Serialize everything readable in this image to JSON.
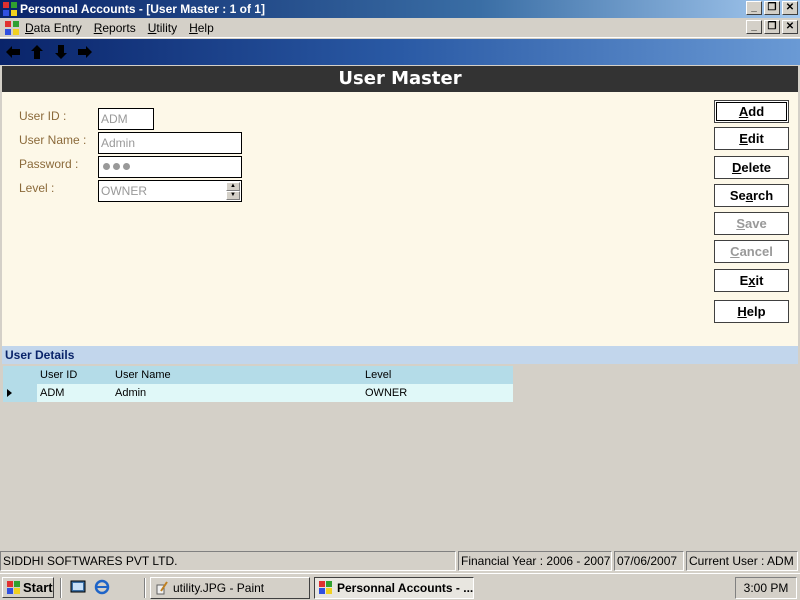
{
  "window": {
    "title": "Personnal Accounts - [User Master : 1 of  1]"
  },
  "menu": {
    "items": [
      {
        "key": "D",
        "rest": "ata Entry"
      },
      {
        "key": "R",
        "rest": "eports"
      },
      {
        "key": "U",
        "rest": "tility"
      },
      {
        "key": "H",
        "rest": "elp"
      }
    ]
  },
  "toolbar": {
    "icons": [
      "arrow-left-icon",
      "arrow-up-icon",
      "arrow-down-icon",
      "arrow-right-icon"
    ]
  },
  "form": {
    "title": "User Master",
    "fields": {
      "user_id": {
        "label": "User ID :",
        "value": "ADM"
      },
      "user_name": {
        "label": "User Name :",
        "value": "Admin"
      },
      "password": {
        "label": "Password :",
        "dot_count": 3
      },
      "level": {
        "label": "Level :",
        "value": "OWNER"
      }
    },
    "buttons": [
      {
        "key": "A",
        "rest": "dd",
        "enabled": true
      },
      {
        "key": "E",
        "rest": "dit",
        "enabled": true
      },
      {
        "key": "D",
        "rest": "elete",
        "enabled": true
      },
      {
        "pre": "Se",
        "key": "a",
        "rest": "rch",
        "enabled": true
      },
      {
        "key": "S",
        "rest": "ave",
        "enabled": false
      },
      {
        "key": "C",
        "rest": "ancel",
        "enabled": false
      },
      {
        "pre": "E",
        "key": "x",
        "rest": "it",
        "enabled": true
      },
      {
        "key": "H",
        "rest": "elp",
        "enabled": true
      }
    ]
  },
  "details": {
    "title": "User Details",
    "columns": [
      "User ID",
      "User Name",
      "Level"
    ],
    "rows": [
      [
        "ADM",
        "Admin",
        "OWNER"
      ]
    ]
  },
  "status": {
    "company": "SIDDHI SOFTWARES PVT LTD.",
    "financial_year": "Financial Year : 2006 - 2007",
    "date": "07/06/2007",
    "current_user": "Current User : ADM"
  },
  "taskbar": {
    "start_label": "Start",
    "tasks": [
      {
        "label": "utility.JPG - Paint",
        "active": false
      },
      {
        "label": "Personnal Accounts - ...",
        "active": true
      }
    ],
    "clock": "3:00 PM"
  },
  "colors": {
    "title_bar": "#0a246a",
    "form_bg": "#fdf8e8",
    "label": "#8b6a3a",
    "header": "#333333",
    "grid_header": "#b4dce8"
  }
}
